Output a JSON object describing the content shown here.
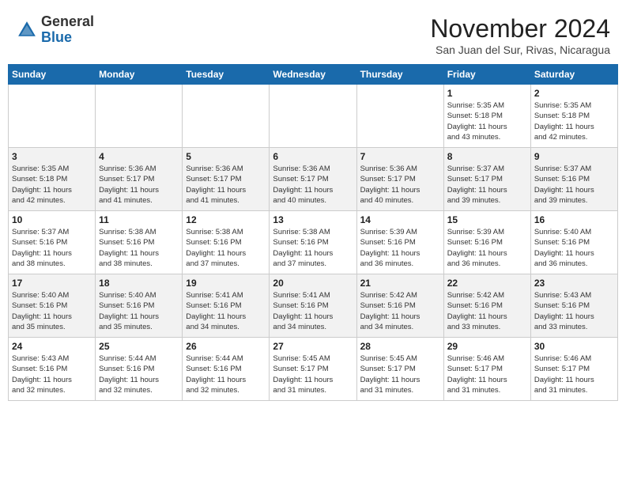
{
  "header": {
    "logo_general": "General",
    "logo_blue": "Blue",
    "month_year": "November 2024",
    "location": "San Juan del Sur, Rivas, Nicaragua"
  },
  "weekdays": [
    "Sunday",
    "Monday",
    "Tuesday",
    "Wednesday",
    "Thursday",
    "Friday",
    "Saturday"
  ],
  "weeks": [
    [
      {
        "day": "",
        "info": ""
      },
      {
        "day": "",
        "info": ""
      },
      {
        "day": "",
        "info": ""
      },
      {
        "day": "",
        "info": ""
      },
      {
        "day": "",
        "info": ""
      },
      {
        "day": "1",
        "info": "Sunrise: 5:35 AM\nSunset: 5:18 PM\nDaylight: 11 hours\nand 43 minutes."
      },
      {
        "day": "2",
        "info": "Sunrise: 5:35 AM\nSunset: 5:18 PM\nDaylight: 11 hours\nand 42 minutes."
      }
    ],
    [
      {
        "day": "3",
        "info": "Sunrise: 5:35 AM\nSunset: 5:18 PM\nDaylight: 11 hours\nand 42 minutes."
      },
      {
        "day": "4",
        "info": "Sunrise: 5:36 AM\nSunset: 5:17 PM\nDaylight: 11 hours\nand 41 minutes."
      },
      {
        "day": "5",
        "info": "Sunrise: 5:36 AM\nSunset: 5:17 PM\nDaylight: 11 hours\nand 41 minutes."
      },
      {
        "day": "6",
        "info": "Sunrise: 5:36 AM\nSunset: 5:17 PM\nDaylight: 11 hours\nand 40 minutes."
      },
      {
        "day": "7",
        "info": "Sunrise: 5:36 AM\nSunset: 5:17 PM\nDaylight: 11 hours\nand 40 minutes."
      },
      {
        "day": "8",
        "info": "Sunrise: 5:37 AM\nSunset: 5:17 PM\nDaylight: 11 hours\nand 39 minutes."
      },
      {
        "day": "9",
        "info": "Sunrise: 5:37 AM\nSunset: 5:16 PM\nDaylight: 11 hours\nand 39 minutes."
      }
    ],
    [
      {
        "day": "10",
        "info": "Sunrise: 5:37 AM\nSunset: 5:16 PM\nDaylight: 11 hours\nand 38 minutes."
      },
      {
        "day": "11",
        "info": "Sunrise: 5:38 AM\nSunset: 5:16 PM\nDaylight: 11 hours\nand 38 minutes."
      },
      {
        "day": "12",
        "info": "Sunrise: 5:38 AM\nSunset: 5:16 PM\nDaylight: 11 hours\nand 37 minutes."
      },
      {
        "day": "13",
        "info": "Sunrise: 5:38 AM\nSunset: 5:16 PM\nDaylight: 11 hours\nand 37 minutes."
      },
      {
        "day": "14",
        "info": "Sunrise: 5:39 AM\nSunset: 5:16 PM\nDaylight: 11 hours\nand 36 minutes."
      },
      {
        "day": "15",
        "info": "Sunrise: 5:39 AM\nSunset: 5:16 PM\nDaylight: 11 hours\nand 36 minutes."
      },
      {
        "day": "16",
        "info": "Sunrise: 5:40 AM\nSunset: 5:16 PM\nDaylight: 11 hours\nand 36 minutes."
      }
    ],
    [
      {
        "day": "17",
        "info": "Sunrise: 5:40 AM\nSunset: 5:16 PM\nDaylight: 11 hours\nand 35 minutes."
      },
      {
        "day": "18",
        "info": "Sunrise: 5:40 AM\nSunset: 5:16 PM\nDaylight: 11 hours\nand 35 minutes."
      },
      {
        "day": "19",
        "info": "Sunrise: 5:41 AM\nSunset: 5:16 PM\nDaylight: 11 hours\nand 34 minutes."
      },
      {
        "day": "20",
        "info": "Sunrise: 5:41 AM\nSunset: 5:16 PM\nDaylight: 11 hours\nand 34 minutes."
      },
      {
        "day": "21",
        "info": "Sunrise: 5:42 AM\nSunset: 5:16 PM\nDaylight: 11 hours\nand 34 minutes."
      },
      {
        "day": "22",
        "info": "Sunrise: 5:42 AM\nSunset: 5:16 PM\nDaylight: 11 hours\nand 33 minutes."
      },
      {
        "day": "23",
        "info": "Sunrise: 5:43 AM\nSunset: 5:16 PM\nDaylight: 11 hours\nand 33 minutes."
      }
    ],
    [
      {
        "day": "24",
        "info": "Sunrise: 5:43 AM\nSunset: 5:16 PM\nDaylight: 11 hours\nand 32 minutes."
      },
      {
        "day": "25",
        "info": "Sunrise: 5:44 AM\nSunset: 5:16 PM\nDaylight: 11 hours\nand 32 minutes."
      },
      {
        "day": "26",
        "info": "Sunrise: 5:44 AM\nSunset: 5:16 PM\nDaylight: 11 hours\nand 32 minutes."
      },
      {
        "day": "27",
        "info": "Sunrise: 5:45 AM\nSunset: 5:17 PM\nDaylight: 11 hours\nand 31 minutes."
      },
      {
        "day": "28",
        "info": "Sunrise: 5:45 AM\nSunset: 5:17 PM\nDaylight: 11 hours\nand 31 minutes."
      },
      {
        "day": "29",
        "info": "Sunrise: 5:46 AM\nSunset: 5:17 PM\nDaylight: 11 hours\nand 31 minutes."
      },
      {
        "day": "30",
        "info": "Sunrise: 5:46 AM\nSunset: 5:17 PM\nDaylight: 11 hours\nand 31 minutes."
      }
    ]
  ]
}
